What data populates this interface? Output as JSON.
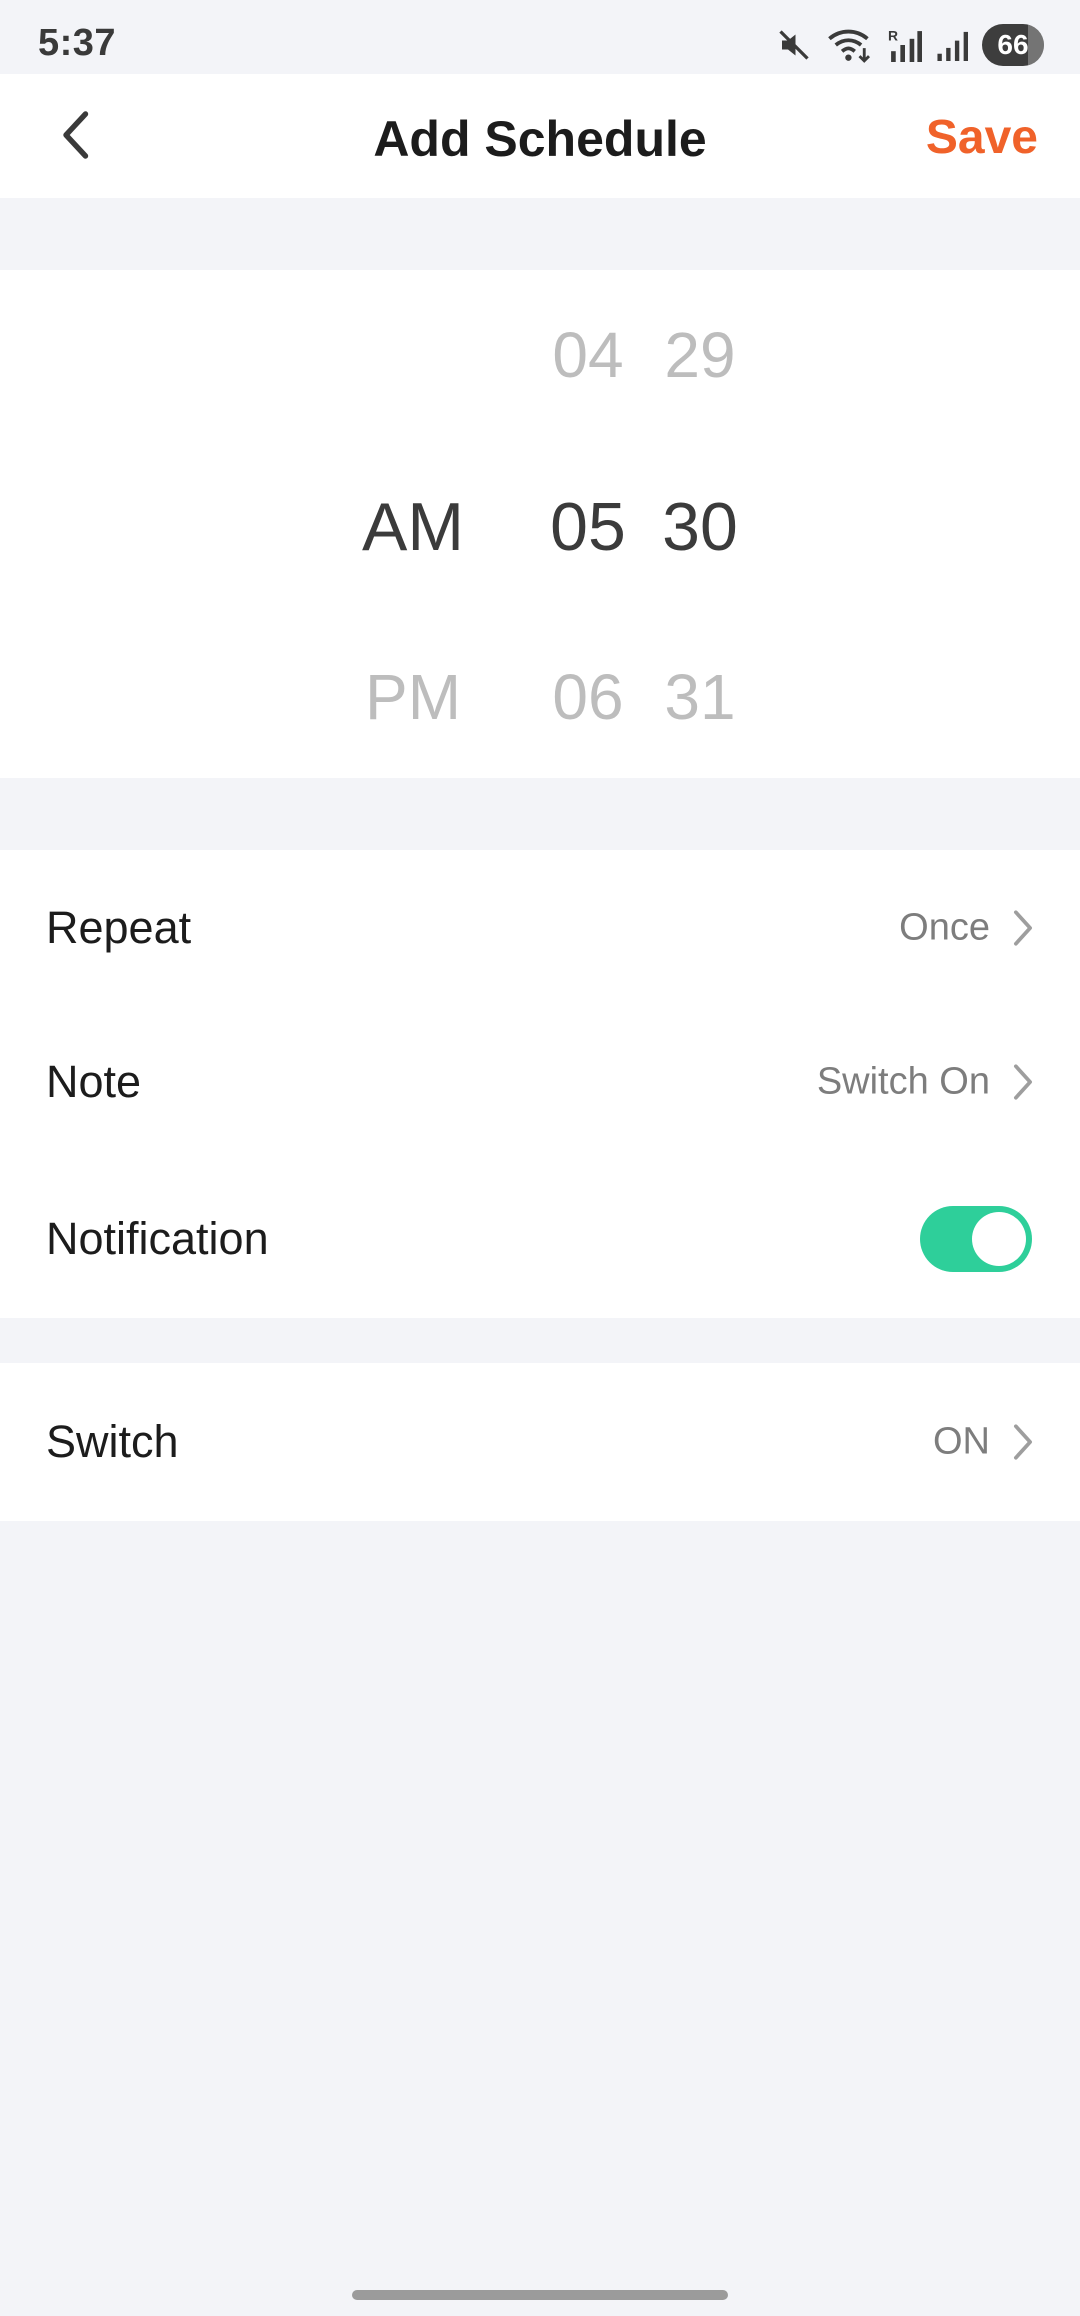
{
  "status_bar": {
    "time": "5:37",
    "battery": "66",
    "icons": [
      "mute-icon",
      "wifi-icon",
      "signal-roaming-icon",
      "signal-icon",
      "battery-icon"
    ]
  },
  "header": {
    "title": "Add Schedule",
    "save_label": "Save",
    "back_icon": "chevron-left-icon"
  },
  "time_picker": {
    "period": {
      "above": "",
      "selected": "AM",
      "below": "PM"
    },
    "hour": {
      "above": "04",
      "selected": "05",
      "below": "06"
    },
    "minute": {
      "above": "29",
      "selected": "30",
      "below": "31"
    }
  },
  "settings": {
    "repeat": {
      "label": "Repeat",
      "value": "Once"
    },
    "note": {
      "label": "Note",
      "value": "Switch On"
    },
    "notification": {
      "label": "Notification",
      "enabled": true
    },
    "switch": {
      "label": "Switch",
      "value": "ON"
    }
  },
  "colors": {
    "accent": "#f0622a",
    "toggle_on": "#2ecf9a",
    "background": "#f3f4f8"
  }
}
